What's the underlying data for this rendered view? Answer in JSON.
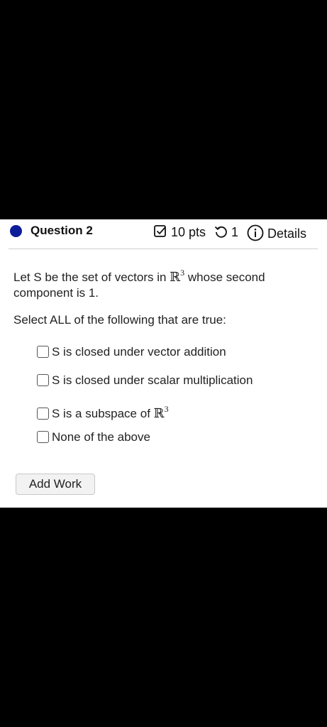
{
  "question": {
    "title": "Question 2",
    "points": "10 pts",
    "attempts": "1",
    "details": "Details"
  },
  "prompt": {
    "line_start": "Let S be the set of vectors in",
    "space": "ℝ",
    "exponent": "3",
    "line_end": "whose second component is 1."
  },
  "instruction": "Select ALL of the following that are true:",
  "options": [
    {
      "label": "S is closed under vector addition",
      "checked": false
    },
    {
      "label": "S is closed under scalar multiplication",
      "checked": false
    },
    {
      "label": "S is a subspace of",
      "space": "ℝ",
      "exponent": "3",
      "checked": false
    },
    {
      "label": "None of the above",
      "checked": false
    }
  ],
  "buttons": {
    "add_work": "Add Work"
  },
  "colors": {
    "status_dot": "#0d1d9a",
    "background": "#000000",
    "panel": "#ffffff"
  },
  "icons": [
    "status-dot",
    "points-check-icon",
    "retry-icon",
    "info-icon",
    "checkbox-icon"
  ]
}
